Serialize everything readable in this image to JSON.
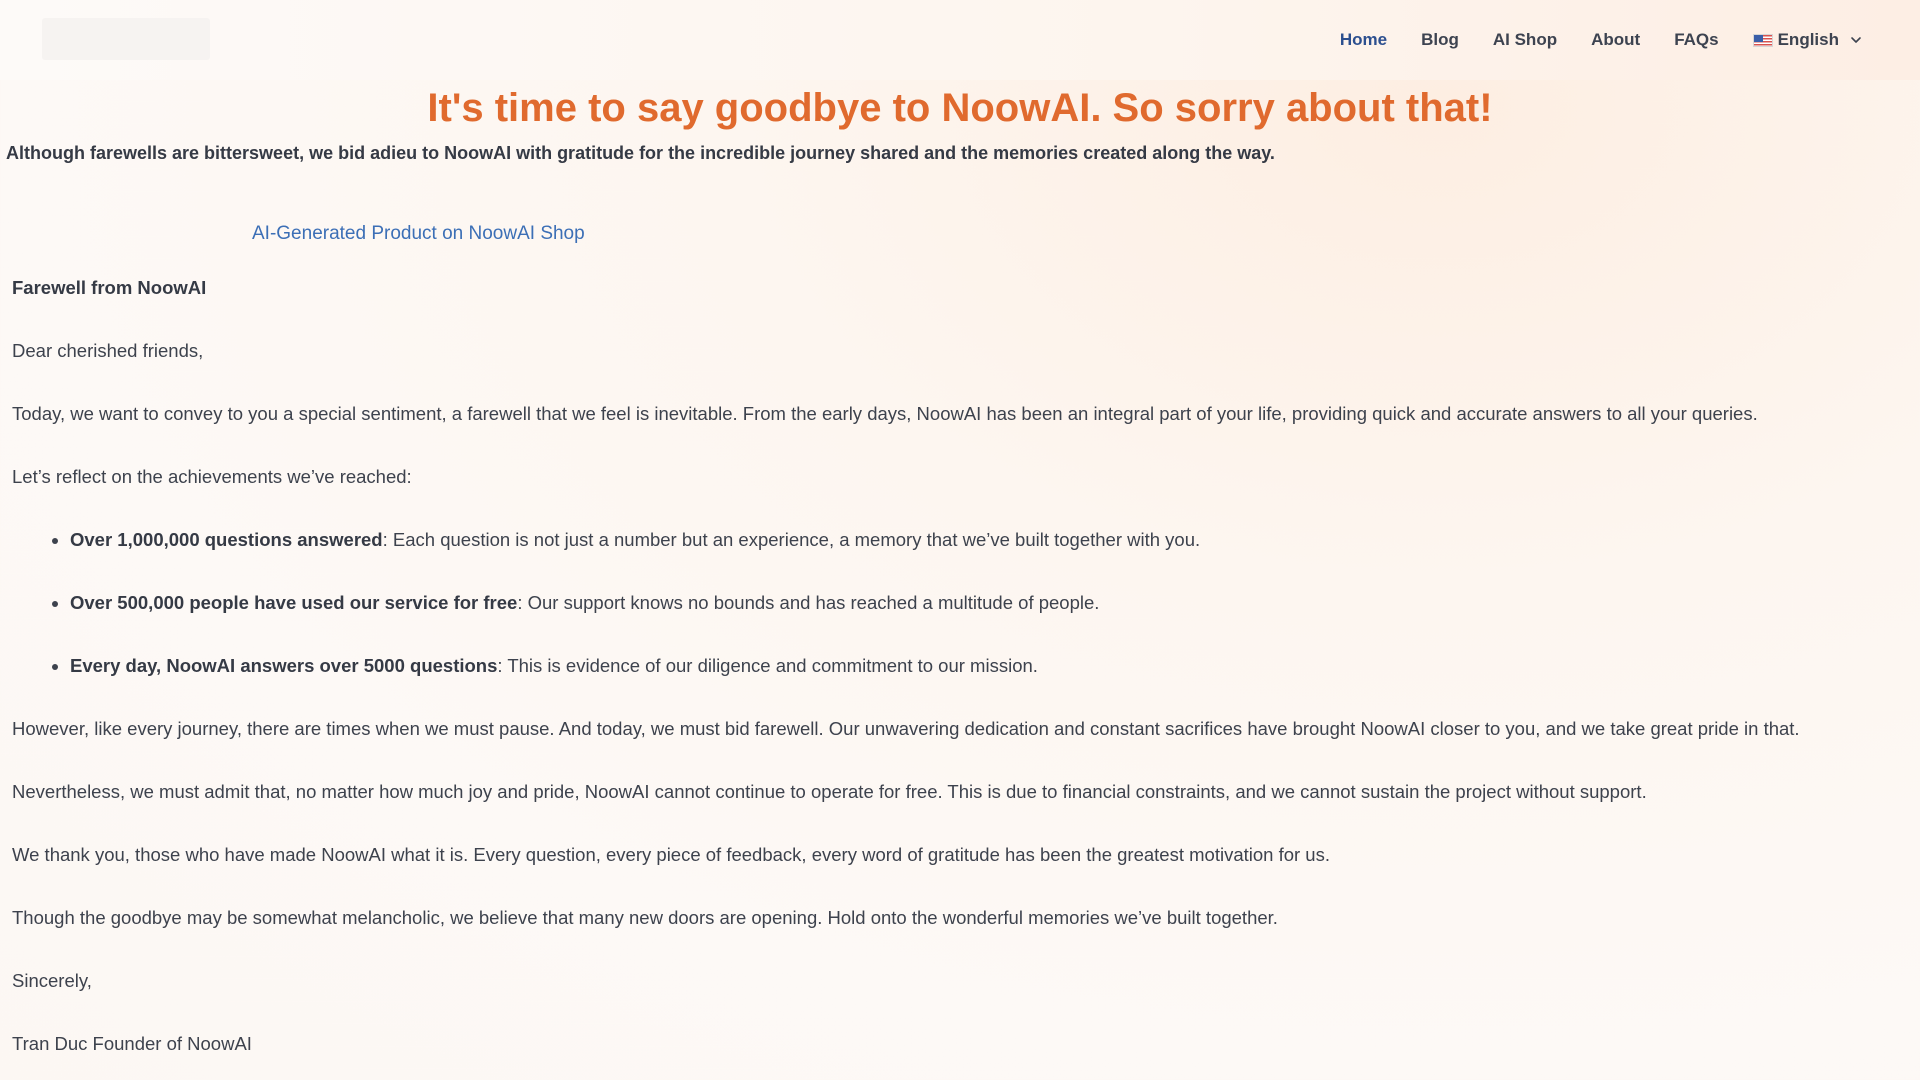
{
  "header": {
    "nav": [
      {
        "label": "Home",
        "active": true
      },
      {
        "label": "Blog",
        "active": false
      },
      {
        "label": "AI Shop",
        "active": false
      },
      {
        "label": "About",
        "active": false
      },
      {
        "label": "FAQs",
        "active": false
      }
    ],
    "language": {
      "label": "English",
      "flag": "us-flag-icon"
    }
  },
  "hero": {
    "title": "It's time to say goodbye to NoowAI. So sorry about that!",
    "subtitle": "Although farewells are bittersweet, we bid adieu to NoowAI with gratitude for the incredible journey shared and the memories created along the way."
  },
  "shop_link": "AI-Generated Product on NoowAI Shop",
  "letter": {
    "heading": "Farewell from NoowAI",
    "greeting": "Dear cherished friends,",
    "intro": "Today, we want to convey to you a special sentiment, a farewell that we feel is inevitable. From the early days, NoowAI has been an integral part of your life, providing quick and accurate answers to all your queries.",
    "reflect": "Let’s reflect on the achievements we’ve reached:",
    "achievements": [
      {
        "bold": "Over 1,000,000 questions answered",
        "text": ": Each question is not just a number but an experience, a memory that we’ve built together with you."
      },
      {
        "bold": "Over 500,000 people have used our service for free",
        "text": ": Our support knows no bounds and has reached a multitude of people."
      },
      {
        "bold": "Every day, NoowAI answers over 5000 questions",
        "text": ": This is evidence of our diligence and commitment to our mission."
      }
    ],
    "paragraph_pause": "However, like every journey, there are times when we must pause. And today, we must bid farewell. Our unwavering dedication and constant sacrifices have brought NoowAI closer to you, and we take great pride in that.",
    "paragraph_funding": "Nevertheless, we must admit that, no matter how much joy and pride, NoowAI cannot continue to operate for free. This is due to financial constraints, and we cannot sustain the project without support.",
    "paragraph_thanks": "We thank you, those who have made NoowAI what it is. Every question, every piece of feedback, every word of gratitude has been the greatest motivation for us.",
    "paragraph_hope": "Though the goodbye may be somewhat melancholic, we believe that many new doors are opening. Hold onto the wonderful memories we’ve built together.",
    "closing": "Sincerely,",
    "signature": "Tran Duc Founder of NoowAI"
  },
  "colors": {
    "title_orange": "#e06a2e",
    "link_blue": "#3c6fb6",
    "nav_active": "#2c4f8f",
    "text": "#3d424d"
  }
}
